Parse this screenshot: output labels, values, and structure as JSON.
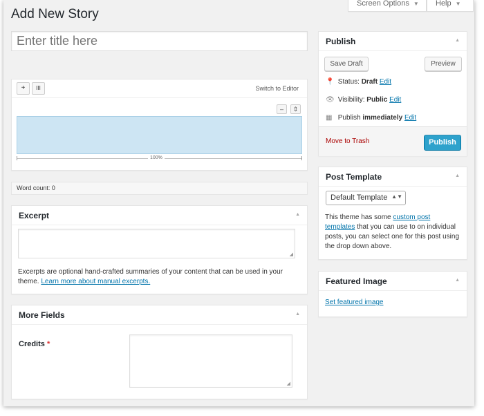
{
  "page": {
    "title": "Add New Story",
    "screen_options": "Screen Options",
    "help": "Help"
  },
  "title_field": {
    "placeholder": "Enter title here",
    "value": ""
  },
  "editor": {
    "add_button": "+",
    "columns_button": "III",
    "switch_label": "Switch to Editor",
    "minus_button": "–",
    "settings_button": "⇕",
    "zoom": "100%"
  },
  "word_count": "Word count: 0",
  "excerpt": {
    "heading": "Excerpt",
    "value": "",
    "help_text": "Excerpts are optional hand-crafted summaries of your content that can be used in your theme.",
    "link": "Learn more about manual excerpts."
  },
  "more_fields": {
    "heading": "More Fields",
    "credits_label": "Credits",
    "required_mark": "*",
    "credits_value": ""
  },
  "publish": {
    "heading": "Publish",
    "save_draft": "Save Draft",
    "preview": "Preview",
    "status_label": "Status:",
    "status_value": "Draft",
    "visibility_label": "Visibility:",
    "visibility_value": "Public",
    "publish_label": "Publish",
    "publish_value": "immediately",
    "edit": "Edit",
    "move_to_trash": "Move to Trash",
    "publish_button": "Publish"
  },
  "post_template": {
    "heading": "Post Template",
    "selected": "Default Template",
    "text_before": "This theme has some",
    "link": "custom post templates",
    "text_after": "that you can use to on individual posts, you can select one for this post using the drop down above."
  },
  "featured_image": {
    "heading": "Featured Image",
    "link": "Set featured image"
  },
  "colors": {
    "accent": "#2ea2cc",
    "link": "#0073aa",
    "trash": "#aa0000",
    "required": "#dc3232",
    "editor_selection": "#cde5f3"
  }
}
